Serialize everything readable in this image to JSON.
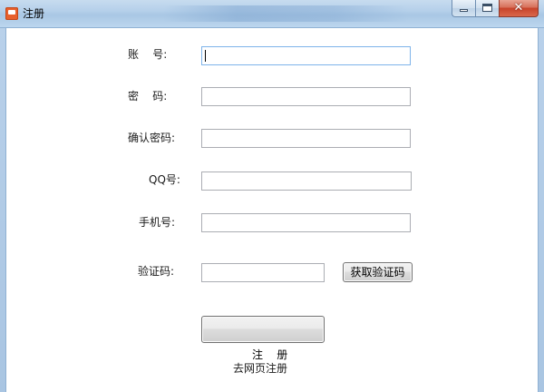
{
  "window": {
    "title": "注册",
    "close_glyph": "✕"
  },
  "form": {
    "account_label": "账    号:",
    "password_label": "密    码:",
    "confirm_password_label": "确认密码:",
    "qq_label": "QQ号:",
    "phone_label": "手机号:",
    "verification_label": "验证码:",
    "account_value": "",
    "password_value": "",
    "confirm_password_value": "",
    "qq_value": "",
    "phone_value": "",
    "verification_value": "",
    "get_code_button": "获取验证码",
    "register_button": "注    册",
    "web_register_link": "去网页注册"
  },
  "icons": {
    "app": "app-icon",
    "minimize": "minimize-icon",
    "maximize": "maximize-icon",
    "close": "close-icon"
  },
  "colors": {
    "titlebar": "#b5d0ea",
    "close_button": "#c7432a",
    "focused_border": "#7eb4ea"
  }
}
